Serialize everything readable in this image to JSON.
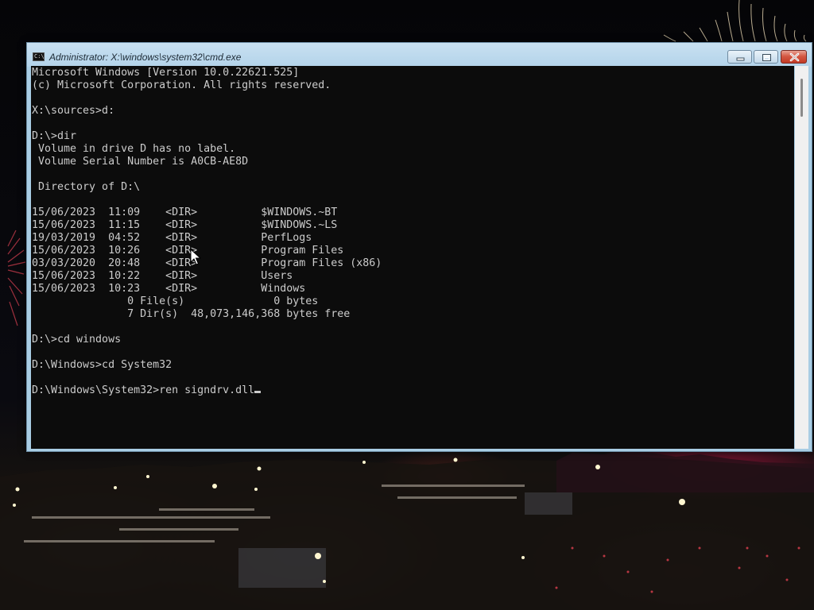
{
  "window": {
    "title": "Administrator: X:\\windows\\system32\\cmd.exe",
    "icon": "cmd-icon",
    "icon_text": "C:\\",
    "controls": [
      "minimize-icon",
      "maximize-icon",
      "close-icon"
    ]
  },
  "console": {
    "lines": [
      "Microsoft Windows [Version 10.0.22621.525]",
      "(c) Microsoft Corporation. All rights reserved.",
      "",
      "X:\\sources>d:",
      "",
      "D:\\>dir",
      " Volume in drive D has no label.",
      " Volume Serial Number is A0CB-AE8D",
      "",
      " Directory of D:\\",
      "",
      "15/06/2023  11:09    <DIR>          $WINDOWS.~BT",
      "15/06/2023  11:15    <DIR>          $WINDOWS.~LS",
      "19/03/2019  04:52    <DIR>          PerfLogs",
      "15/06/2023  10:26    <DIR>          Program Files",
      "03/03/2020  20:48    <DIR>          Program Files (x86)",
      "15/06/2023  10:22    <DIR>          Users",
      "15/06/2023  10:23    <DIR>          Windows",
      "               0 File(s)              0 bytes",
      "               7 Dir(s)  48,073,146,368 bytes free",
      "",
      "D:\\>cd windows",
      "",
      "D:\\Windows>cd System32",
      ""
    ],
    "prompt": "D:\\Windows\\System32>",
    "input": "ren signdrv.dll"
  },
  "colors": {
    "console_bg": "#0c0c0c",
    "console_text": "#cccccc",
    "titlebar": "#b3d3ea",
    "close_button": "#c33a25"
  }
}
